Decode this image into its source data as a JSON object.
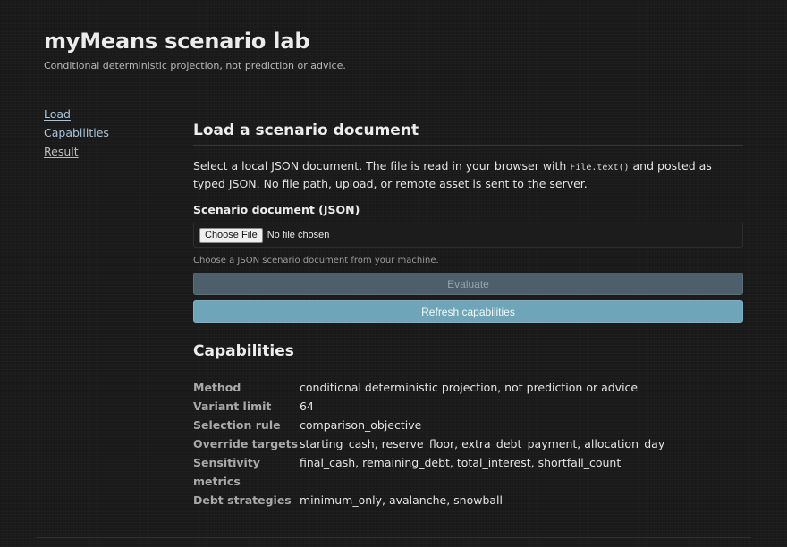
{
  "header": {
    "title": "myMeans scenario lab",
    "subtitle": "Conditional deterministic projection, not prediction or advice."
  },
  "nav": {
    "items": [
      "Load",
      "Capabilities",
      "Result"
    ]
  },
  "load_section": {
    "heading": "Load a scenario document",
    "description_before": "Select a local JSON document. The file is read in your browser with ",
    "description_code": "File.text()",
    "description_after": " and posted as typed JSON. No file path, upload, or remote asset is sent to the server.",
    "field_label": "Scenario document (JSON)",
    "choose_file_label": "Choose File",
    "file_status": "No file chosen",
    "help_text": "Choose a JSON scenario document from your machine.",
    "evaluate_label": "Evaluate",
    "evaluate_disabled": true,
    "refresh_label": "Refresh capabilities"
  },
  "capabilities": {
    "heading": "Capabilities",
    "rows": [
      {
        "key": "Method",
        "value": "conditional deterministic projection, not prediction or advice"
      },
      {
        "key": "Variant limit",
        "value": "64"
      },
      {
        "key": "Selection rule",
        "value": "comparison_objective"
      },
      {
        "key": "Override targets",
        "value": "starting_cash, reserve_floor, extra_debt_payment, allocation_day"
      },
      {
        "key": "Sensitivity metrics",
        "value": "final_cash, remaining_debt, total_interest, shortfall_count"
      },
      {
        "key": "Debt strategies",
        "value": "minimum_only, avalanche, snowball"
      }
    ]
  },
  "colors": {
    "background": "#1b1b1c",
    "link": "#a8c4dc",
    "refresh_button": "#6ea5b9",
    "evaluate_button_disabled": "#4c5f6a"
  }
}
